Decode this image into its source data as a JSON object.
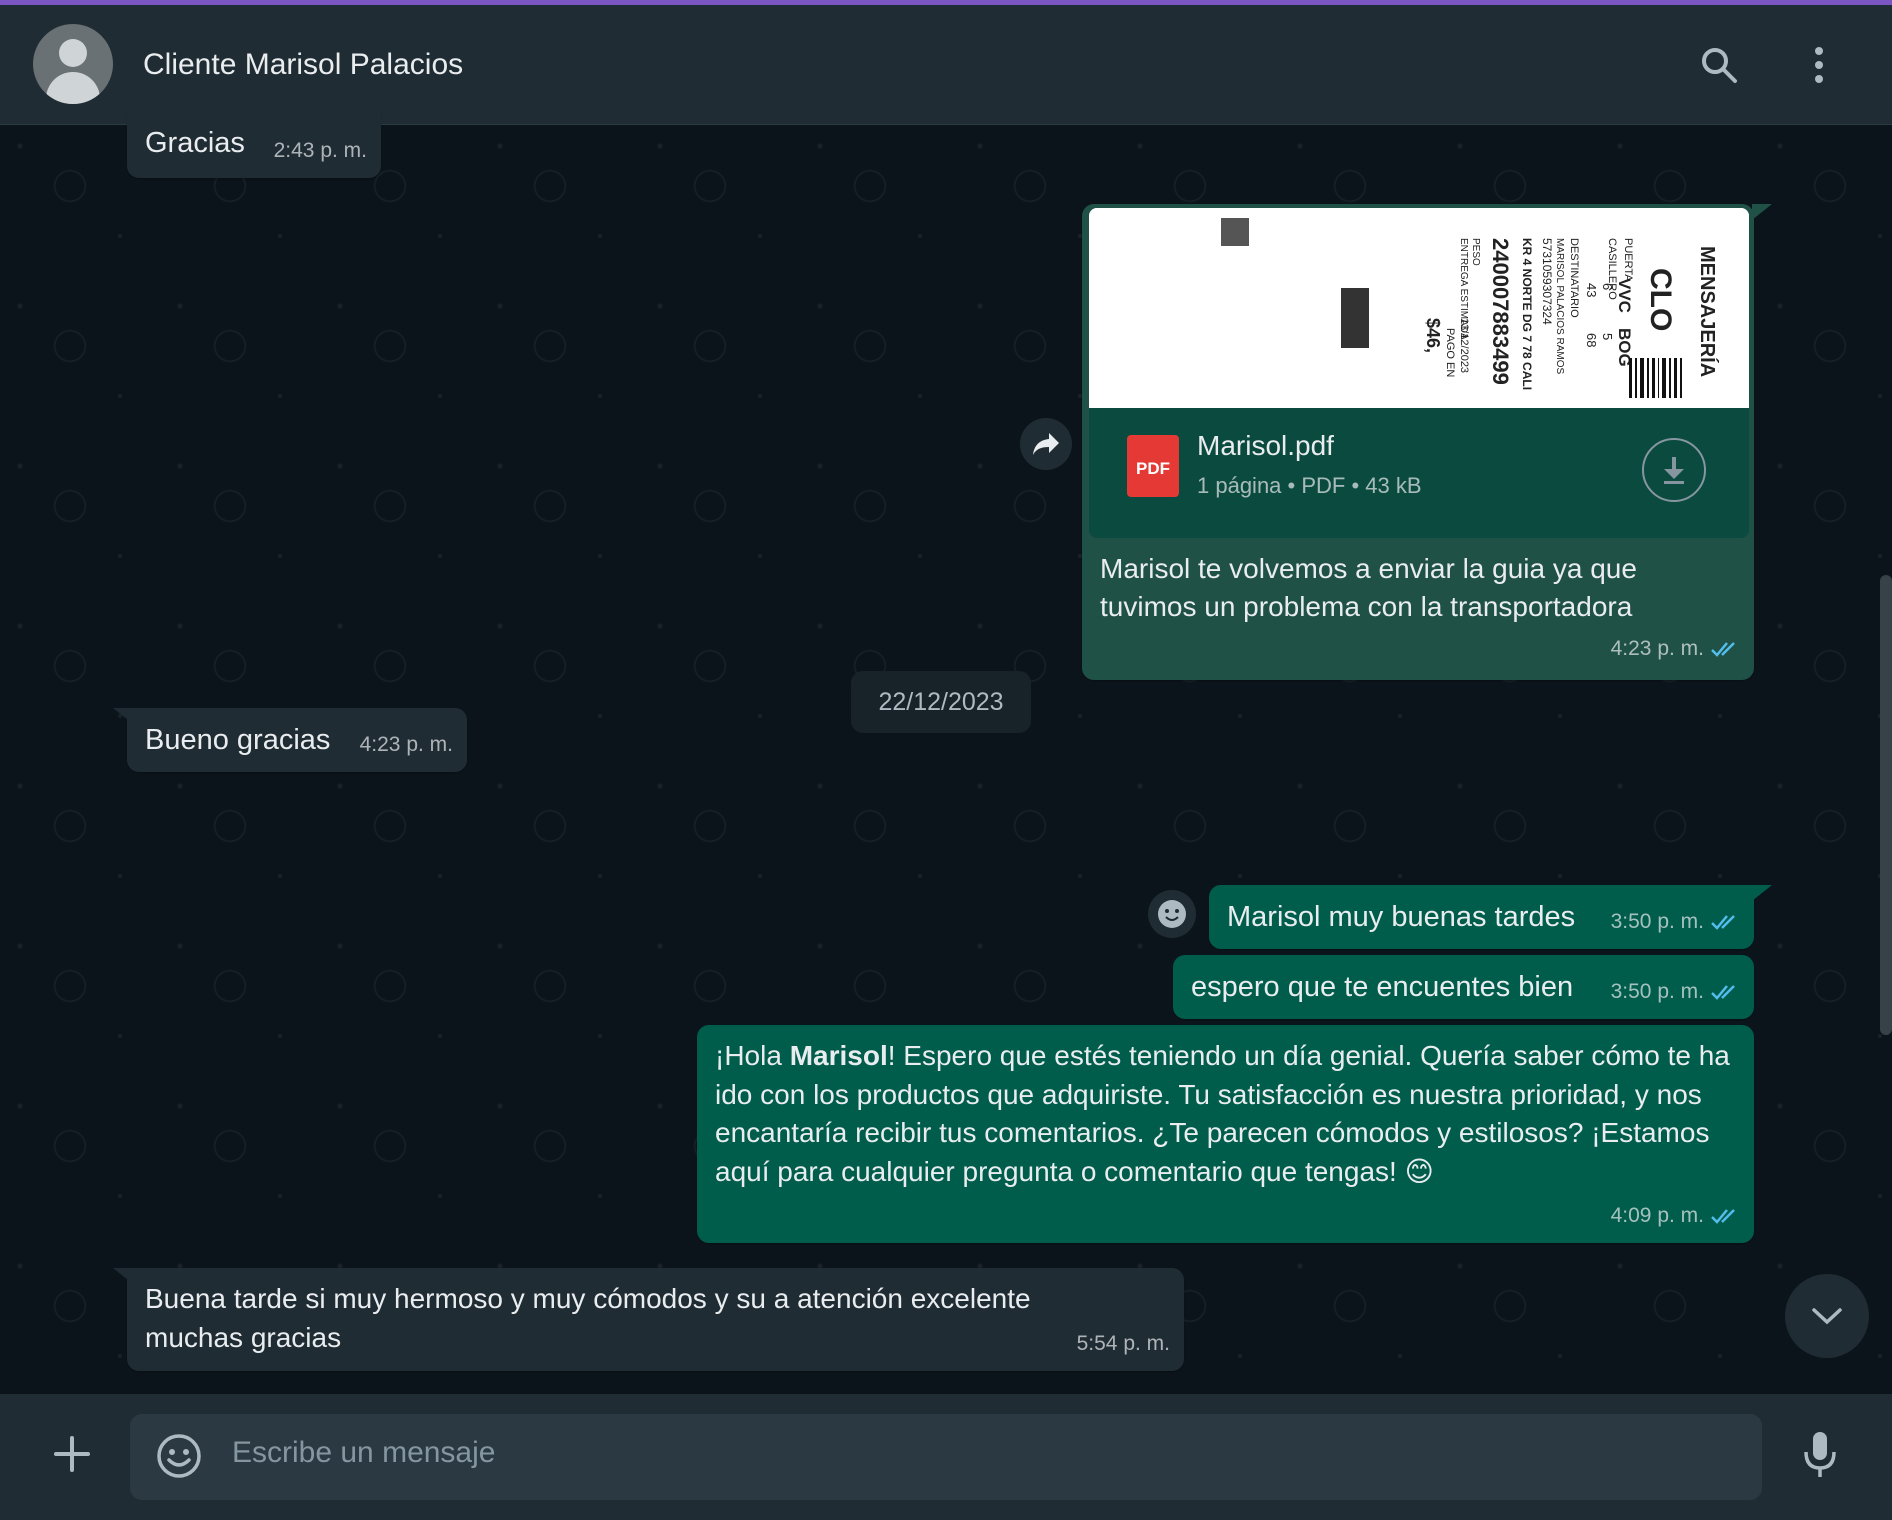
{
  "header": {
    "contact_name": "Cliente Marisol Palacios",
    "icons": [
      "search-icon",
      "menu-icon"
    ]
  },
  "messages": [
    {
      "dir": "in",
      "text": "Gracias",
      "time": "2:43 p. m."
    },
    {
      "dir": "out",
      "document": {
        "file_name": "Marisol.pdf",
        "pages": "1 página",
        "type": "PDF",
        "size": "43 kB",
        "icon_label": "PDF",
        "preview": {
          "brand": "MENSAJERÍA",
          "code": "CLO",
          "guide_number": "240007883499",
          "lines": [
            "PUERTA",
            "CASILLERO",
            "DESTINATARIO",
            "MARISOL PALACIOS RAMOS",
            "5731059307324",
            "KR 4 NORTE DG 7 78 CALI",
            "VVC",
            "BOG",
            "6",
            "5",
            "43",
            "68",
            "PESO",
            "ENTREGA ESTIMADA",
            "13/12/2023",
            "PAGO EN",
            "$46,"
          ]
        }
      },
      "text": "Marisol te volvemos a enviar la guia ya que tuvimos un problema con la transportadora",
      "time": "4:23 p. m."
    },
    {
      "dir": "in",
      "text": "Bueno gracias",
      "time": "4:23 p. m."
    },
    {
      "dir": "out",
      "text": "Marisol muy buenas tardes",
      "time": "3:50 p. m."
    },
    {
      "dir": "out",
      "text": "espero que te encuentes bien",
      "time": "3:50 p. m."
    },
    {
      "dir": "out",
      "text_pre": "¡Hola ",
      "text_bold": "Marisol",
      "text_post": "! Espero que estés teniendo un día genial. Quería saber cómo te ha ido con los productos que adquiriste. Tu satisfacción es nuestra prioridad, y nos encantaría recibir tus comentarios. ¿Te parecen cómodos y estilosos? ¡Estamos aquí para cualquier pregunta o comentario que tengas! 😊",
      "time": "4:09 p. m."
    },
    {
      "dir": "in",
      "text": "Buena tarde si muy hermoso y muy cómodos y su a atención excelente muchas gracias",
      "time": "5:54 p. m."
    }
  ],
  "date_separator": "22/12/2023",
  "composer": {
    "placeholder": "Escribe un mensaje"
  },
  "colors": {
    "background": "#0b141a",
    "incoming": "#202c33",
    "outgoing": "#005c4b",
    "read_ticks": "#53bdeb",
    "accent_strip": "#7a56c2"
  }
}
